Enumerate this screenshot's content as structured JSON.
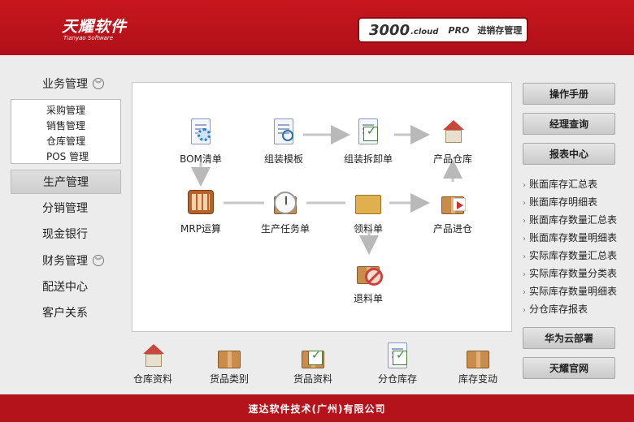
{
  "header": {
    "logo_cn": "天耀软件",
    "logo_en": "Tianyao Software",
    "product_num": "3000",
    "product_cloud": ".cloud",
    "product_pro": "PRO",
    "product_name": "进销存管理"
  },
  "sidebar": {
    "business": "业务管理",
    "sub_items": [
      "采购管理",
      "销售管理",
      "仓库管理",
      "POS 管理"
    ],
    "production": "生产管理",
    "distribution": "分销管理",
    "cash_bank": "现金银行",
    "finance": "财务管理",
    "delivery": "配送中心",
    "crm": "客户关系"
  },
  "flow": {
    "bom": "BOM清单",
    "assembly_template": "组装模板",
    "assembly_disassembly": "组装拆卸单",
    "product_warehouse": "产品仓库",
    "mrp": "MRP运算",
    "production_task": "生产任务单",
    "material_requisition": "领料单",
    "product_inbound": "产品进仓",
    "material_return": "退料单"
  },
  "quick": {
    "warehouse_info": "仓库资料",
    "goods_category": "货品类别",
    "goods_info": "货品资料",
    "branch_stock": "分仓库存",
    "stock_change": "库存变动"
  },
  "right": {
    "manual": "操作手册",
    "manager_query": "经理查询",
    "report_center": "报表中心",
    "reports": [
      "账面库存汇总表",
      "账面库存明细表",
      "账面库存数量汇总表",
      "账面库存数量明细表",
      "实际库存数量汇总表",
      "实际库存数量分类表",
      "实际库存数量明细表",
      "分仓库存报表"
    ],
    "huawei": "华为云部署",
    "official": "天耀官网"
  },
  "footer": {
    "company": "速达软件技术(广州)有限公司"
  },
  "colors": {
    "brand_red": "#c8161d",
    "footer_red": "#b5131b"
  }
}
